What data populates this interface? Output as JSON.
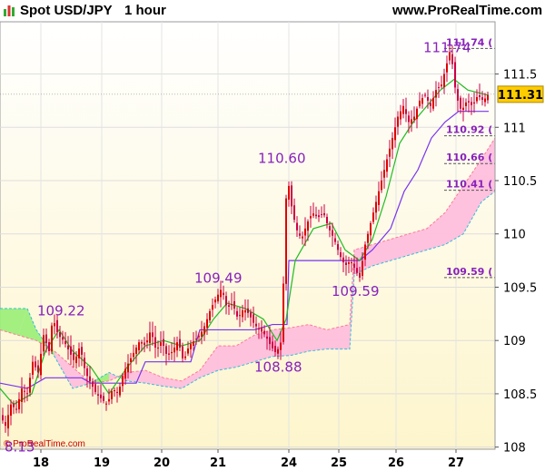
{
  "header": {
    "title": "Spot USD/JPY",
    "interval": "1 hour",
    "site": "www.ProRealTime.com"
  },
  "copyright": "© ProRealTime.com",
  "colors": {
    "candle_up": "#dd0000",
    "candle_down": "#cc0044",
    "tenkan": "#22bb22",
    "kijun": "#7733ee",
    "cloud_bull": "#99ee77",
    "cloud_bear": "#ffbbdd",
    "label": "#8822bb",
    "price_box": "#ffcc00"
  },
  "chart_data": {
    "type": "candlestick",
    "ylim": [
      107.98,
      111.99
    ],
    "y_ticks": [
      108,
      108.5,
      109,
      109.5,
      110,
      110.5,
      111,
      111.5
    ],
    "y_tick_labels": [
      "108",
      "108.5",
      "109",
      "109.5",
      "110",
      "110.5",
      "111",
      "111.5"
    ],
    "x_tick_labels": [
      "18",
      "19",
      "20",
      "21",
      "24",
      "25",
      "26",
      "27"
    ],
    "grid": true,
    "last_price": "111.31",
    "right_levels": [
      {
        "value": 111.74,
        "label": "111.74"
      },
      {
        "value": 110.92,
        "label": "110.92"
      },
      {
        "value": 110.66,
        "label": "110.66"
      },
      {
        "value": 110.41,
        "label": "110.41"
      },
      {
        "value": 109.59,
        "label": "109.59"
      }
    ],
    "annotations": [
      {
        "label": "8.13",
        "day": "18",
        "value": 108.13
      },
      {
        "label": "109.22",
        "day": "18",
        "value": 109.22
      },
      {
        "label": "109.49",
        "day": "21",
        "value": 109.49
      },
      {
        "label": "108.88",
        "day": "24",
        "value": 108.88
      },
      {
        "label": "110.60",
        "day": "24",
        "value": 110.6
      },
      {
        "label": "109.59",
        "day": "25",
        "value": 109.59
      },
      {
        "label": "111.74",
        "day": "27",
        "value": 111.74
      }
    ],
    "close_path": [
      [
        0,
        108.3
      ],
      [
        6,
        108.2
      ],
      [
        12,
        108.4
      ],
      [
        18,
        108.35
      ],
      [
        24,
        108.55
      ],
      [
        30,
        108.5
      ],
      [
        36,
        108.8
      ],
      [
        42,
        108.7
      ],
      [
        48,
        109.05
      ],
      [
        54,
        108.9
      ],
      [
        58,
        109.22
      ],
      [
        64,
        109.05
      ],
      [
        70,
        109.0
      ],
      [
        76,
        108.9
      ],
      [
        82,
        108.8
      ],
      [
        88,
        108.95
      ],
      [
        94,
        108.7
      ],
      [
        100,
        108.6
      ],
      [
        106,
        108.5
      ],
      [
        112,
        108.45
      ],
      [
        118,
        108.4
      ],
      [
        124,
        108.55
      ],
      [
        130,
        108.5
      ],
      [
        136,
        108.7
      ],
      [
        142,
        108.8
      ],
      [
        148,
        108.9
      ],
      [
        154,
        109.0
      ],
      [
        160,
        108.95
      ],
      [
        166,
        109.1
      ],
      [
        172,
        108.9
      ],
      [
        178,
        109.0
      ],
      [
        184,
        108.85
      ],
      [
        190,
        108.9
      ],
      [
        196,
        109.0
      ],
      [
        202,
        108.8
      ],
      [
        208,
        108.95
      ],
      [
        214,
        109.0
      ],
      [
        220,
        109.05
      ],
      [
        226,
        109.15
      ],
      [
        232,
        109.3
      ],
      [
        238,
        109.4
      ],
      [
        244,
        109.49
      ],
      [
        250,
        109.3
      ],
      [
        256,
        109.35
      ],
      [
        262,
        109.2
      ],
      [
        268,
        109.3
      ],
      [
        274,
        109.25
      ],
      [
        280,
        109.15
      ],
      [
        286,
        109.1
      ],
      [
        292,
        109.05
      ],
      [
        298,
        108.95
      ],
      [
        304,
        108.88
      ],
      [
        310,
        109.0
      ],
      [
        316,
        110.6
      ],
      [
        320,
        110.3
      ],
      [
        326,
        110.05
      ],
      [
        332,
        109.95
      ],
      [
        338,
        110.1
      ],
      [
        344,
        110.2
      ],
      [
        350,
        110.15
      ],
      [
        356,
        110.2
      ],
      [
        362,
        110.05
      ],
      [
        368,
        109.95
      ],
      [
        374,
        109.8
      ],
      [
        380,
        109.7
      ],
      [
        386,
        109.75
      ],
      [
        392,
        109.65
      ],
      [
        396,
        109.59
      ],
      [
        402,
        109.9
      ],
      [
        408,
        110.1
      ],
      [
        414,
        110.3
      ],
      [
        420,
        110.5
      ],
      [
        426,
        110.7
      ],
      [
        432,
        110.9
      ],
      [
        438,
        111.1
      ],
      [
        444,
        111.2
      ],
      [
        450,
        111.05
      ],
      [
        456,
        111.1
      ],
      [
        462,
        111.25
      ],
      [
        468,
        111.3
      ],
      [
        474,
        111.2
      ],
      [
        480,
        111.35
      ],
      [
        486,
        111.4
      ],
      [
        492,
        111.6
      ],
      [
        496,
        111.74
      ],
      [
        502,
        111.3
      ],
      [
        508,
        111.15
      ],
      [
        514,
        111.25
      ],
      [
        520,
        111.2
      ],
      [
        526,
        111.3
      ],
      [
        532,
        111.25
      ],
      [
        538,
        111.31
      ]
    ],
    "tenkan": [
      [
        0,
        108.55
      ],
      [
        15,
        108.4
      ],
      [
        35,
        108.5
      ],
      [
        50,
        108.9
      ],
      [
        65,
        109.1
      ],
      [
        80,
        108.9
      ],
      [
        100,
        108.75
      ],
      [
        120,
        108.5
      ],
      [
        140,
        108.75
      ],
      [
        160,
        108.95
      ],
      [
        180,
        109.0
      ],
      [
        200,
        108.95
      ],
      [
        220,
        109.0
      ],
      [
        235,
        109.2
      ],
      [
        250,
        109.35
      ],
      [
        270,
        109.3
      ],
      [
        290,
        109.2
      ],
      [
        305,
        109.0
      ],
      [
        315,
        109.2
      ],
      [
        325,
        109.75
      ],
      [
        345,
        110.05
      ],
      [
        365,
        110.1
      ],
      [
        380,
        109.85
      ],
      [
        396,
        109.75
      ],
      [
        410,
        109.95
      ],
      [
        425,
        110.35
      ],
      [
        440,
        110.85
      ],
      [
        455,
        111.05
      ],
      [
        470,
        111.2
      ],
      [
        485,
        111.35
      ],
      [
        500,
        111.45
      ],
      [
        515,
        111.35
      ],
      [
        538,
        111.3
      ]
    ],
    "kijun": [
      [
        0,
        108.6
      ],
      [
        30,
        108.55
      ],
      [
        50,
        108.65
      ],
      [
        90,
        108.65
      ],
      [
        100,
        108.6
      ],
      [
        150,
        108.6
      ],
      [
        160,
        108.8
      ],
      [
        210,
        108.8
      ],
      [
        220,
        109.1
      ],
      [
        280,
        109.1
      ],
      [
        300,
        109.15
      ],
      [
        316,
        109.15
      ],
      [
        318,
        109.75
      ],
      [
        396,
        109.75
      ],
      [
        410,
        109.85
      ],
      [
        430,
        110.05
      ],
      [
        445,
        110.4
      ],
      [
        460,
        110.6
      ],
      [
        475,
        110.9
      ],
      [
        490,
        111.05
      ],
      [
        505,
        111.15
      ],
      [
        538,
        111.15
      ]
    ],
    "cloud_a": [
      [
        0,
        109.1
      ],
      [
        20,
        109.05
      ],
      [
        40,
        109.0
      ],
      [
        60,
        108.9
      ],
      [
        80,
        108.75
      ],
      [
        100,
        108.6
      ],
      [
        120,
        108.62
      ],
      [
        140,
        108.7
      ],
      [
        160,
        108.72
      ],
      [
        180,
        108.65
      ],
      [
        200,
        108.62
      ],
      [
        220,
        108.72
      ],
      [
        240,
        108.95
      ],
      [
        260,
        108.95
      ],
      [
        280,
        109.05
      ],
      [
        300,
        109.1
      ],
      [
        320,
        109.12
      ],
      [
        340,
        109.15
      ],
      [
        360,
        109.1
      ],
      [
        385,
        109.15
      ],
      [
        390,
        109.85
      ],
      [
        410,
        109.9
      ],
      [
        430,
        109.95
      ],
      [
        450,
        110.0
      ],
      [
        470,
        110.05
      ],
      [
        490,
        110.2
      ],
      [
        510,
        110.45
      ],
      [
        530,
        110.7
      ],
      [
        545,
        110.9
      ]
    ],
    "cloud_b": [
      [
        0,
        109.3
      ],
      [
        30,
        109.3
      ],
      [
        40,
        109.1
      ],
      [
        60,
        108.85
      ],
      [
        80,
        108.55
      ],
      [
        100,
        108.6
      ],
      [
        120,
        108.7
      ],
      [
        140,
        108.62
      ],
      [
        160,
        108.6
      ],
      [
        180,
        108.57
      ],
      [
        200,
        108.55
      ],
      [
        220,
        108.65
      ],
      [
        240,
        108.72
      ],
      [
        260,
        108.75
      ],
      [
        280,
        108.8
      ],
      [
        300,
        108.85
      ],
      [
        320,
        108.86
      ],
      [
        340,
        108.9
      ],
      [
        360,
        108.92
      ],
      [
        385,
        108.92
      ],
      [
        390,
        109.62
      ],
      [
        410,
        109.7
      ],
      [
        430,
        109.75
      ],
      [
        450,
        109.8
      ],
      [
        470,
        109.85
      ],
      [
        490,
        109.9
      ],
      [
        510,
        110.0
      ],
      [
        530,
        110.3
      ],
      [
        545,
        110.4
      ]
    ]
  }
}
